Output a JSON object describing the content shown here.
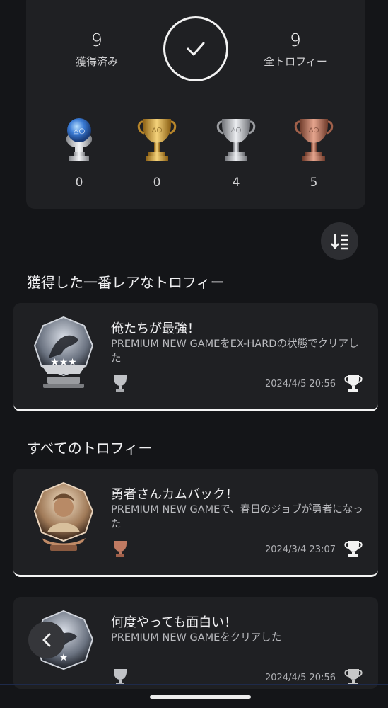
{
  "summary": {
    "earned_count": "9",
    "earned_label": "獲得済み",
    "total_count": "9",
    "total_label": "全トロフィー",
    "trophies": [
      {
        "kind": "platinum",
        "count": "0",
        "color": "#3a7bd5"
      },
      {
        "kind": "gold",
        "count": "0",
        "color": "#d4a437"
      },
      {
        "kind": "silver",
        "count": "4",
        "color": "#c0c2c6"
      },
      {
        "kind": "bronze",
        "count": "5",
        "color": "#c07a62"
      }
    ]
  },
  "rarest_section_title": "獲得した一番レアなトロフィー",
  "all_section_title": "すべてのトロフィー",
  "rarest_trophy": {
    "name": "俺たちが最強！",
    "description": "PREMIUM NEW GAMEをEX-HARDの状態でクリアした",
    "grade": "silver",
    "date": "2024/4/5  20:56"
  },
  "trophy_list": [
    {
      "name": "勇者さんカムバック！",
      "description": "PREMIUM NEW GAMEで、春日のジョブが勇者になった",
      "grade": "bronze",
      "date": "2024/3/4  23:07"
    },
    {
      "name": "何度やっても面白い！",
      "description": "PREMIUM NEW GAMEをクリアした",
      "grade": "silver",
      "date": "2024/4/5  20:56"
    }
  ],
  "icons": {
    "check": "check-icon",
    "sort": "sort-icon",
    "back": "chevron-left-icon",
    "earned": "trophy-earned-icon"
  }
}
